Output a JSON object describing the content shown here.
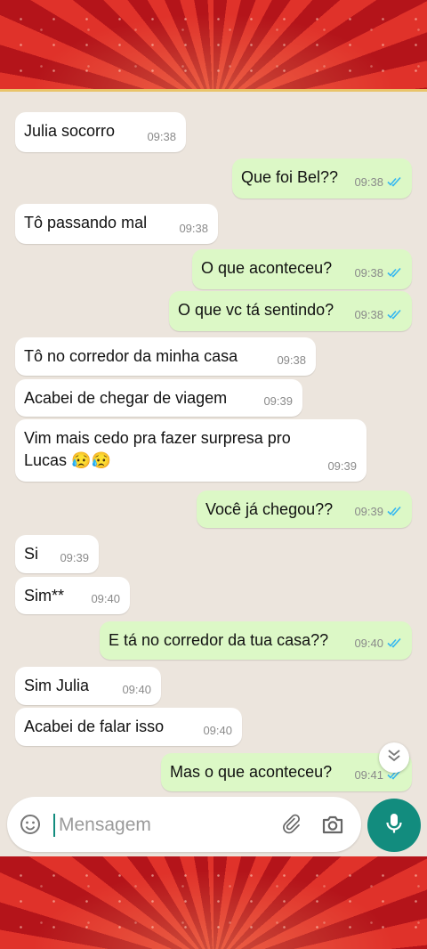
{
  "messages": [
    {
      "dir": "in",
      "text": "Julia socorro",
      "time": "09:38"
    },
    {
      "dir": "out",
      "text": "Que foi Bel??",
      "time": "09:38"
    },
    {
      "dir": "in",
      "text": "Tô passando mal",
      "time": "09:38"
    },
    {
      "dir": "out",
      "text": "O que aconteceu?",
      "time": "09:38"
    },
    {
      "dir": "out",
      "text": "O que vc tá sentindo?",
      "time": "09:38"
    },
    {
      "dir": "in",
      "text": "Tô no corredor da minha casa",
      "time": "09:38"
    },
    {
      "dir": "in",
      "text": "Acabei de chegar de viagem",
      "time": "09:39"
    },
    {
      "dir": "in",
      "text": "Vim mais cedo pra fazer surpresa pro",
      "text_line2": "Lucas 😥😥",
      "time": "09:39"
    },
    {
      "dir": "out",
      "text": "Você já chegou??",
      "time": "09:39"
    },
    {
      "dir": "in",
      "text": "Si",
      "time": "09:39"
    },
    {
      "dir": "in",
      "text": "Sim**",
      "time": "09:40"
    },
    {
      "dir": "out",
      "text": "E tá no corredor da tua casa??",
      "time": "09:40"
    },
    {
      "dir": "in",
      "text": "Sim Julia",
      "time": "09:40"
    },
    {
      "dir": "in",
      "text": "Acabei de falar isso",
      "time": "09:40"
    },
    {
      "dir": "out",
      "text": "Mas o que aconteceu?",
      "time": "09:41"
    }
  ],
  "composer": {
    "placeholder": "Mensagem",
    "icons": [
      "emoji-icon",
      "attach-icon",
      "camera-icon",
      "mic-icon"
    ]
  },
  "status": {
    "read_ticks": "double-check-blue",
    "scroll_button_icon": "chevron-down-double-icon"
  },
  "colors": {
    "chat_bg": "#ece5dd",
    "incoming": "#ffffff",
    "outgoing": "#dcf8c6",
    "tick_blue": "#34b7f1",
    "accent": "#128c7e",
    "banner_red": "#c81d1d"
  }
}
